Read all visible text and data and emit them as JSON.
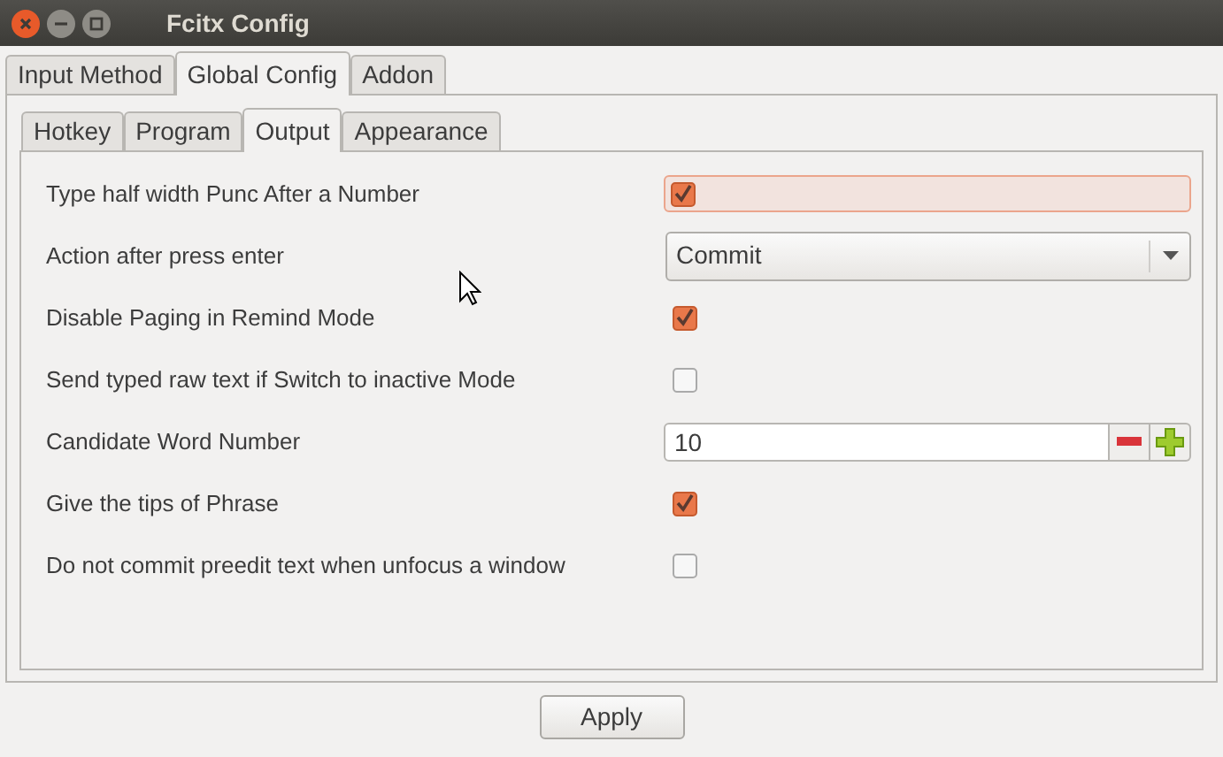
{
  "window": {
    "title": "Fcitx Config"
  },
  "tabs": [
    {
      "label": "Input Method",
      "selected": false
    },
    {
      "label": "Global Config",
      "selected": true
    },
    {
      "label": "Addon",
      "selected": false
    }
  ],
  "subtabs": [
    {
      "label": "Hotkey",
      "selected": false
    },
    {
      "label": "Program",
      "selected": false
    },
    {
      "label": "Output",
      "selected": true
    },
    {
      "label": "Appearance",
      "selected": false
    }
  ],
  "options": [
    {
      "kind": "checkbox",
      "label": "Type half width Punc After a Number",
      "checked": true,
      "focused": true
    },
    {
      "kind": "combo",
      "label": "Action after press enter",
      "value": "Commit",
      "focused": false
    },
    {
      "kind": "checkbox",
      "label": "Disable Paging in Remind Mode",
      "checked": true,
      "focused": false
    },
    {
      "kind": "checkbox",
      "label": "Send typed raw text if Switch to inactive Mode",
      "checked": false,
      "focused": false
    },
    {
      "kind": "spin",
      "label": "Candidate Word Number",
      "value": "10",
      "focused": false
    },
    {
      "kind": "checkbox",
      "label": "Give the tips of Phrase",
      "checked": true,
      "focused": false
    },
    {
      "kind": "checkbox",
      "label": "Do not commit preedit text when unfocus a window",
      "checked": false,
      "focused": false
    }
  ],
  "buttons": [
    "Apply"
  ]
}
